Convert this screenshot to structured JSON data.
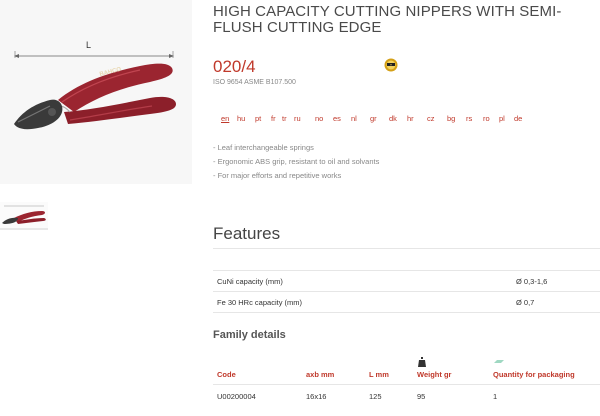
{
  "product": {
    "title": "HIGH CAPACITY CUTTING NIPPERS WITH SEMI-FLUSH CUTTING EDGE",
    "code": "020/4",
    "standard": "ISO 9654 ASME B107.500",
    "dimension_label": "L",
    "handle_brand": "BAHCO",
    "badge_icon": "quality-seal-icon"
  },
  "languages": [
    "en",
    "hu",
    "pt",
    "fr",
    "tr",
    "ru",
    "no",
    "es",
    "nl",
    "gr",
    "dk",
    "hr",
    "cz",
    "bg",
    "rs",
    "ro",
    "pl",
    "de"
  ],
  "active_language": "en",
  "bullets": [
    "- Leaf interchangeable springs",
    "- Ergonomic ABS grip, resistant to oil and solvants",
    "- For major efforts and repetitive works"
  ],
  "features": {
    "heading": "Features",
    "rows": [
      {
        "label": "CuNi capacity (mm)",
        "value": "Ø 0,3-1,6"
      },
      {
        "label": "Fe 30 HRc capacity (mm)",
        "value": "Ø 0,7"
      }
    ]
  },
  "family": {
    "heading": "Family details",
    "columns": [
      "Code",
      "axb mm",
      "L mm",
      "Weight gr",
      "Quantity for packaging"
    ],
    "rows": [
      [
        "U00200004",
        "16x16",
        "125",
        "95",
        "1"
      ]
    ]
  },
  "colors": {
    "accent": "#c0392b",
    "handle": "#9b2530",
    "metal": "#3a3a3a"
  }
}
